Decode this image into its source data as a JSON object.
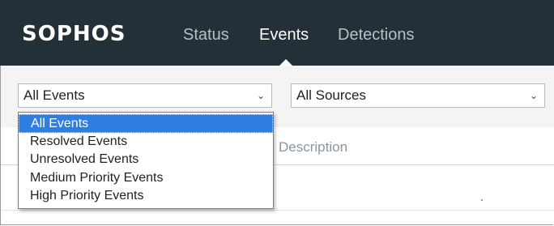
{
  "brand": {
    "logo_text": "SOPHOS"
  },
  "nav": {
    "items": [
      {
        "label": "Status",
        "active": false
      },
      {
        "label": "Events",
        "active": true
      },
      {
        "label": "Detections",
        "active": false
      }
    ]
  },
  "filters": {
    "event_filter": {
      "value": "All Events",
      "open": true,
      "options": [
        "All Events",
        "Resolved Events",
        "Unresolved Events",
        "Medium Priority Events",
        "High Priority Events"
      ],
      "highlighted": "All Events"
    },
    "source_filter": {
      "value": "All Sources"
    }
  },
  "table": {
    "columns": [
      "Description"
    ]
  },
  "colors": {
    "topbar_bg": "#233037",
    "nav_active": "#ffffff",
    "nav_inactive": "#b7c0c6",
    "highlight": "#2f7fe0",
    "filter_bar_bg": "#f4f4f4"
  },
  "icons": {
    "select_chevron": "chevron-down-icon",
    "active_nav_indicator": "caret-up-icon"
  }
}
